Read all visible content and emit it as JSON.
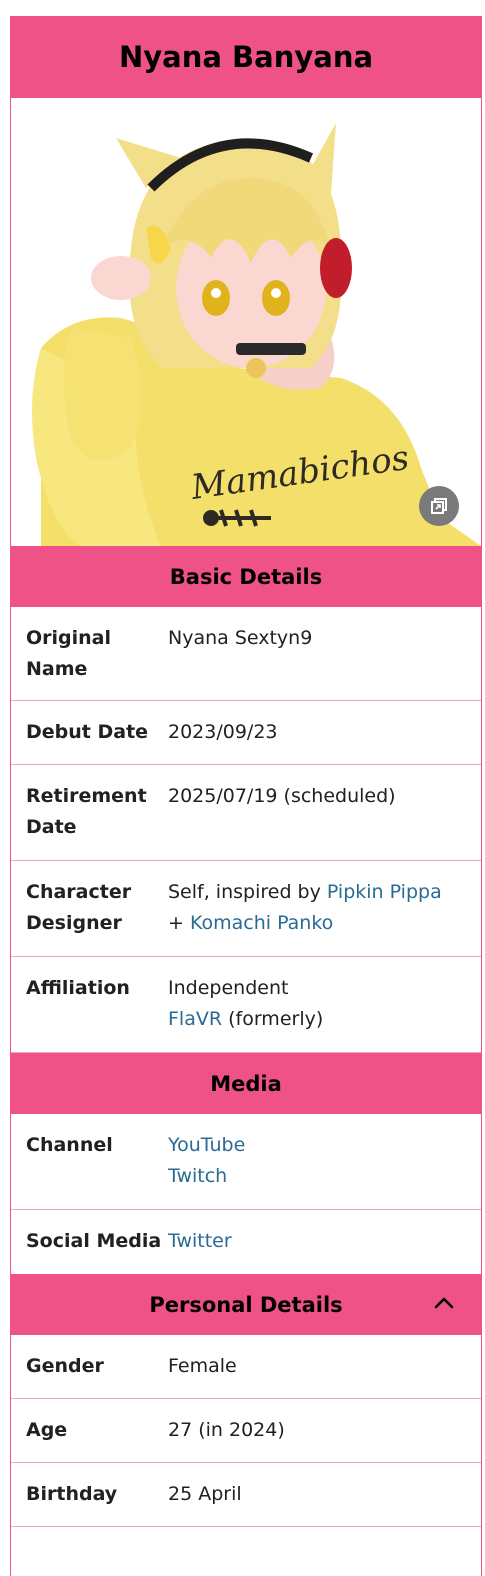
{
  "title": "Nyana Banyana",
  "image": {
    "shirt_text": "Mamabichos",
    "expand_icon": "expand-icon"
  },
  "basic": {
    "header": "Basic Details",
    "original_name_label": "Original Name",
    "original_name": "Nyana Sextyn9",
    "debut_label": "Debut Date",
    "debut": "2023/09/23",
    "retire_label": "Retirement Date",
    "retire": "2025/07/19 (scheduled)",
    "designer_label": "Character Designer",
    "designer_prefix": "Self, inspired by ",
    "designer_link1": "Pipkin Pippa",
    "designer_plus": "+ ",
    "designer_link2": "Komachi Panko",
    "affiliation_label": "Affiliation",
    "affiliation": "Independent",
    "affiliation_link": "FlaVR",
    "affiliation_suffix": " (formerly)"
  },
  "media": {
    "header": "Media",
    "channel_label": "Channel",
    "channel_1": "YouTube",
    "channel_2": "Twitch",
    "social_label": "Social Media",
    "social_1": "Twitter"
  },
  "personal": {
    "header": "Personal Details",
    "collapse_icon": "chevron-up-icon",
    "gender_label": "Gender",
    "gender": "Female",
    "age_label": "Age",
    "age": "27 (in 2024)",
    "birthday_label": "Birthday",
    "birthday": "25 April"
  },
  "colors": {
    "accent": "#ee5286",
    "link": "#2a6b94",
    "divider": "#f3a3bd"
  }
}
